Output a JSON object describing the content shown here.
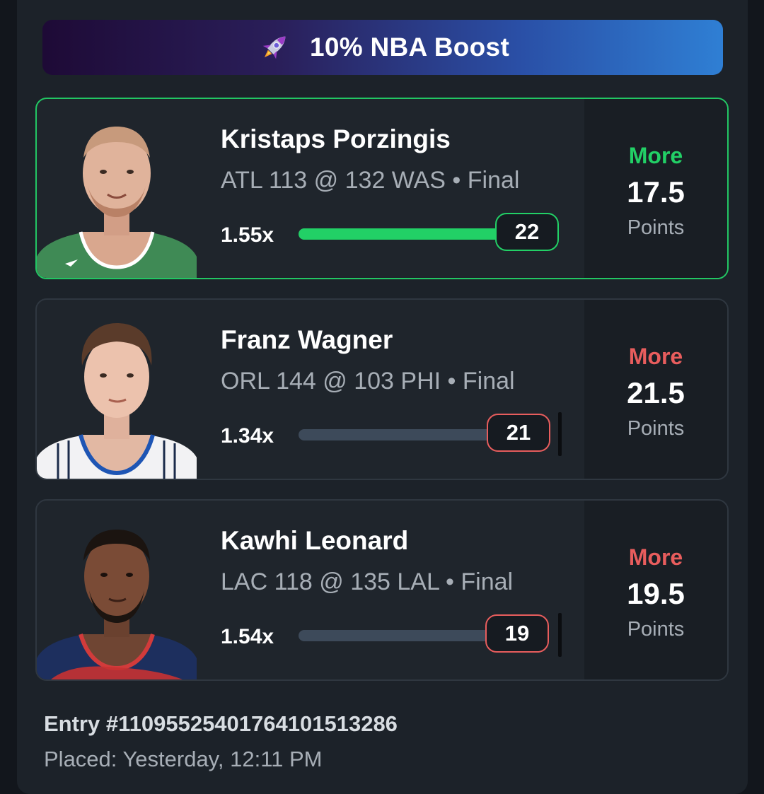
{
  "boost": {
    "icon": "rocket-icon",
    "label": "10% NBA Boost",
    "gradient": [
      "#1e0a36",
      "#2f7fd4"
    ]
  },
  "picks": [
    {
      "player": "Kristaps Porzingis",
      "game": "ATL 113 @ 132 WAS • Final",
      "multiplier": "1.55x",
      "actual": "22",
      "direction": "More",
      "line": "17.5",
      "stat": "Points",
      "result": "win",
      "direction_color": "#22d066",
      "jersey": "green"
    },
    {
      "player": "Franz Wagner",
      "game": "ORL 144 @ 103 PHI • Final",
      "multiplier": "1.34x",
      "actual": "21",
      "direction": "More",
      "line": "21.5",
      "stat": "Points",
      "result": "loss",
      "direction_color": "#e85d5d",
      "jersey": "white-pinstripe"
    },
    {
      "player": "Kawhi Leonard",
      "game": "LAC 118 @ 135 LAL • Final",
      "multiplier": "1.54x",
      "actual": "19",
      "direction": "More",
      "line": "19.5",
      "stat": "Points",
      "result": "loss",
      "direction_color": "#e85d5d",
      "jersey": "navy"
    }
  ],
  "entry": {
    "id": "Entry #1109552540176410151328­6",
    "placed": "Placed: Yesterday, 12:11 PM"
  },
  "colors": {
    "win": "#22d066",
    "loss": "#e85d5d",
    "track": "#3d4a5a"
  }
}
